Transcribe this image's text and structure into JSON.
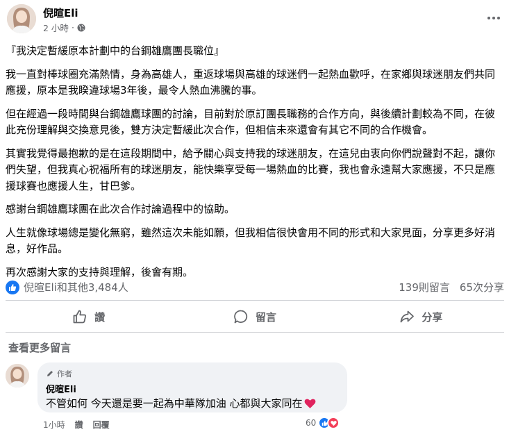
{
  "post": {
    "author": "倪暄Eli",
    "time": "2 小時",
    "paragraphs": [
      "『我決定暫緩原本計劃中的台鋼雄鷹團長職位』",
      "我一直對棒球圈充滿熱情，身為高雄人，重返球場與高雄的球迷們一起熱血歡呼，在家鄉與球迷朋友們共同應援，原本是我睽違球場3年後，最令人熱血沸騰的事。",
      "但在經過一段時間與台鋼雄鷹球團的討論，目前對於原訂團長職務的合作方向，與後續計劃較為不同，在彼此充份理解與交換意見後，雙方決定暫緩此次合作，但相信未來還會有其它不同的合作機會。",
      "其實我覺得最抱歉的是在這段期間中，給予關心與支持我的球迷朋友，在這兒由衷向你們說聲對不起，讓你們失望，但我真心祝福所有的球迷朋友，能快樂享受每一場熱血的比賽，我也會永遠幫大家應援，不只是應援球賽也應援人生，甘巴爹。",
      "感謝台鋼雄鷹球團在此次合作討論過程中的協助。",
      "人生就像球場總是變化無窮，雖然這次未能如願，但我相信很快會用不同的形式和大家見面，分享更多好消息，好作品。",
      "再次感謝大家的支持與理解，後會有期。"
    ]
  },
  "reactions": {
    "summary": "倪暄Eli和其他3,484人",
    "comments": "139則留言",
    "shares": "65次分享"
  },
  "actions": {
    "like": "讚",
    "comment": "留言",
    "share": "分享"
  },
  "comments_section": {
    "view_more": "查看更多留言",
    "comment": {
      "badge": "作者",
      "author": "倪暄Eli",
      "text": "不管如何 今天還是要一起為中華隊加油 心都與大家同在",
      "time": "1小時",
      "like_label": "讚",
      "reply_label": "回覆",
      "reaction_count": "60"
    }
  },
  "colors": {
    "like_blue": "#1877f2",
    "love_red": "#f33e58",
    "secondary_text": "#65676b",
    "bubble_bg": "#f0f2f5"
  }
}
